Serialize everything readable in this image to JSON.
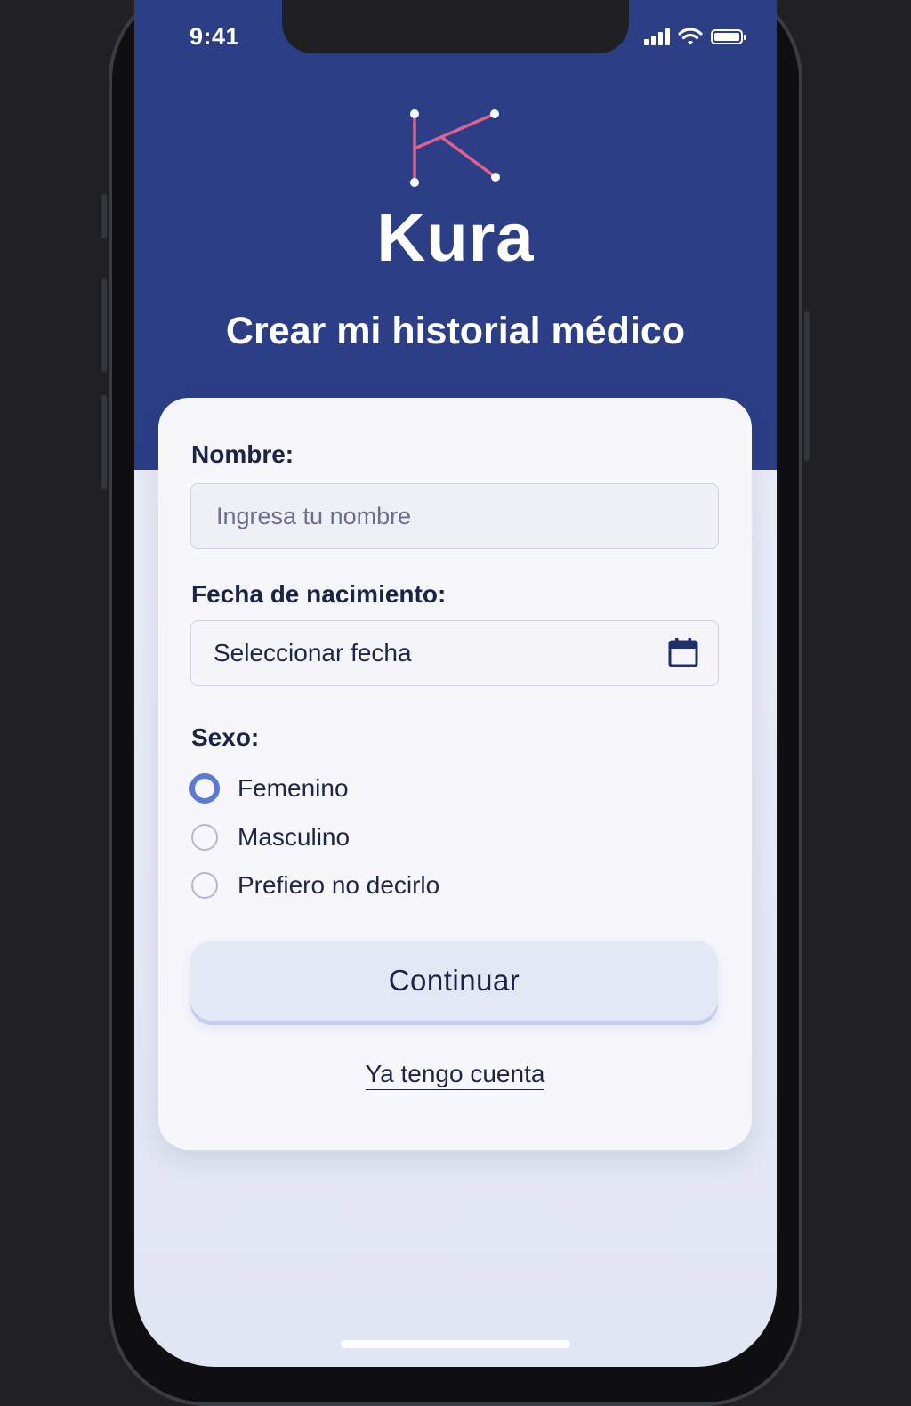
{
  "status_bar": {
    "time": "9:41"
  },
  "header": {
    "brand_name": "Kura",
    "title": "Crear mi historial médico"
  },
  "form": {
    "name_label": "Nombre:",
    "name_placeholder": "Ingresa tu nombre",
    "name_value": "",
    "birthdate_label": "Fecha de nacimiento:",
    "birthdate_value": "Seleccionar fecha",
    "sex_label": "Sexo:",
    "sex_options": [
      {
        "label": "Femenino",
        "selected": true
      },
      {
        "label": "Masculino",
        "selected": false
      },
      {
        "label": "Prefiero no decirlo",
        "selected": false
      }
    ],
    "continue_label": "Continuar",
    "existing_account_link": "Ya tengo cuenta"
  },
  "icons": {
    "logo": "kura-logo-icon",
    "calendar": "calendar-icon",
    "signal": "cellular-signal-icon",
    "wifi": "wifi-icon",
    "battery": "battery-icon"
  },
  "colors": {
    "header_background": "#2c3f86",
    "logo_accent": "#e0608f",
    "radio_selected": "#5b7ad4",
    "text_dark": "#1b2347"
  }
}
